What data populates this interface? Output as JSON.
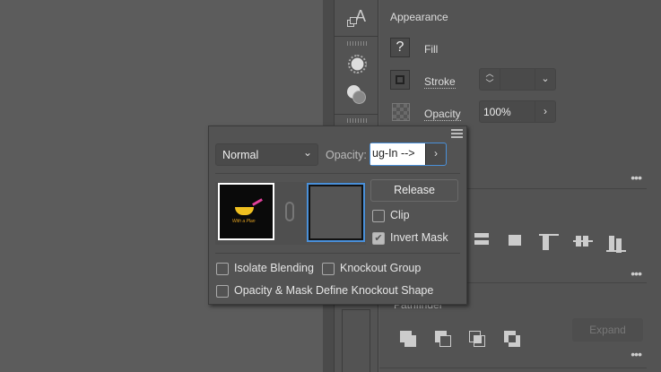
{
  "appearance": {
    "title": "Appearance",
    "fill_label": "Fill",
    "fill_icon": "?",
    "stroke_label": "Stroke",
    "opacity_label": "Opacity",
    "opacity_value": "100%"
  },
  "pathfinder": {
    "title": "Pathfinder",
    "expand_label": "Expand"
  },
  "popup": {
    "blend_mode": "Normal",
    "opacity_label": "Opacity:",
    "opacity_input": "ug-In  -->",
    "release_label": "Release",
    "clip_label": "Clip",
    "invert_mask_label": "Invert Mask",
    "invert_mask_checked": true,
    "clip_checked": false,
    "isolate_label": "Isolate Blending",
    "knockout_label": "Knockout Group",
    "define_knockout_label": "Opacity & Mask Define Knockout Shape",
    "thumb_text": "With a Plan"
  },
  "more_icon": "•••"
}
